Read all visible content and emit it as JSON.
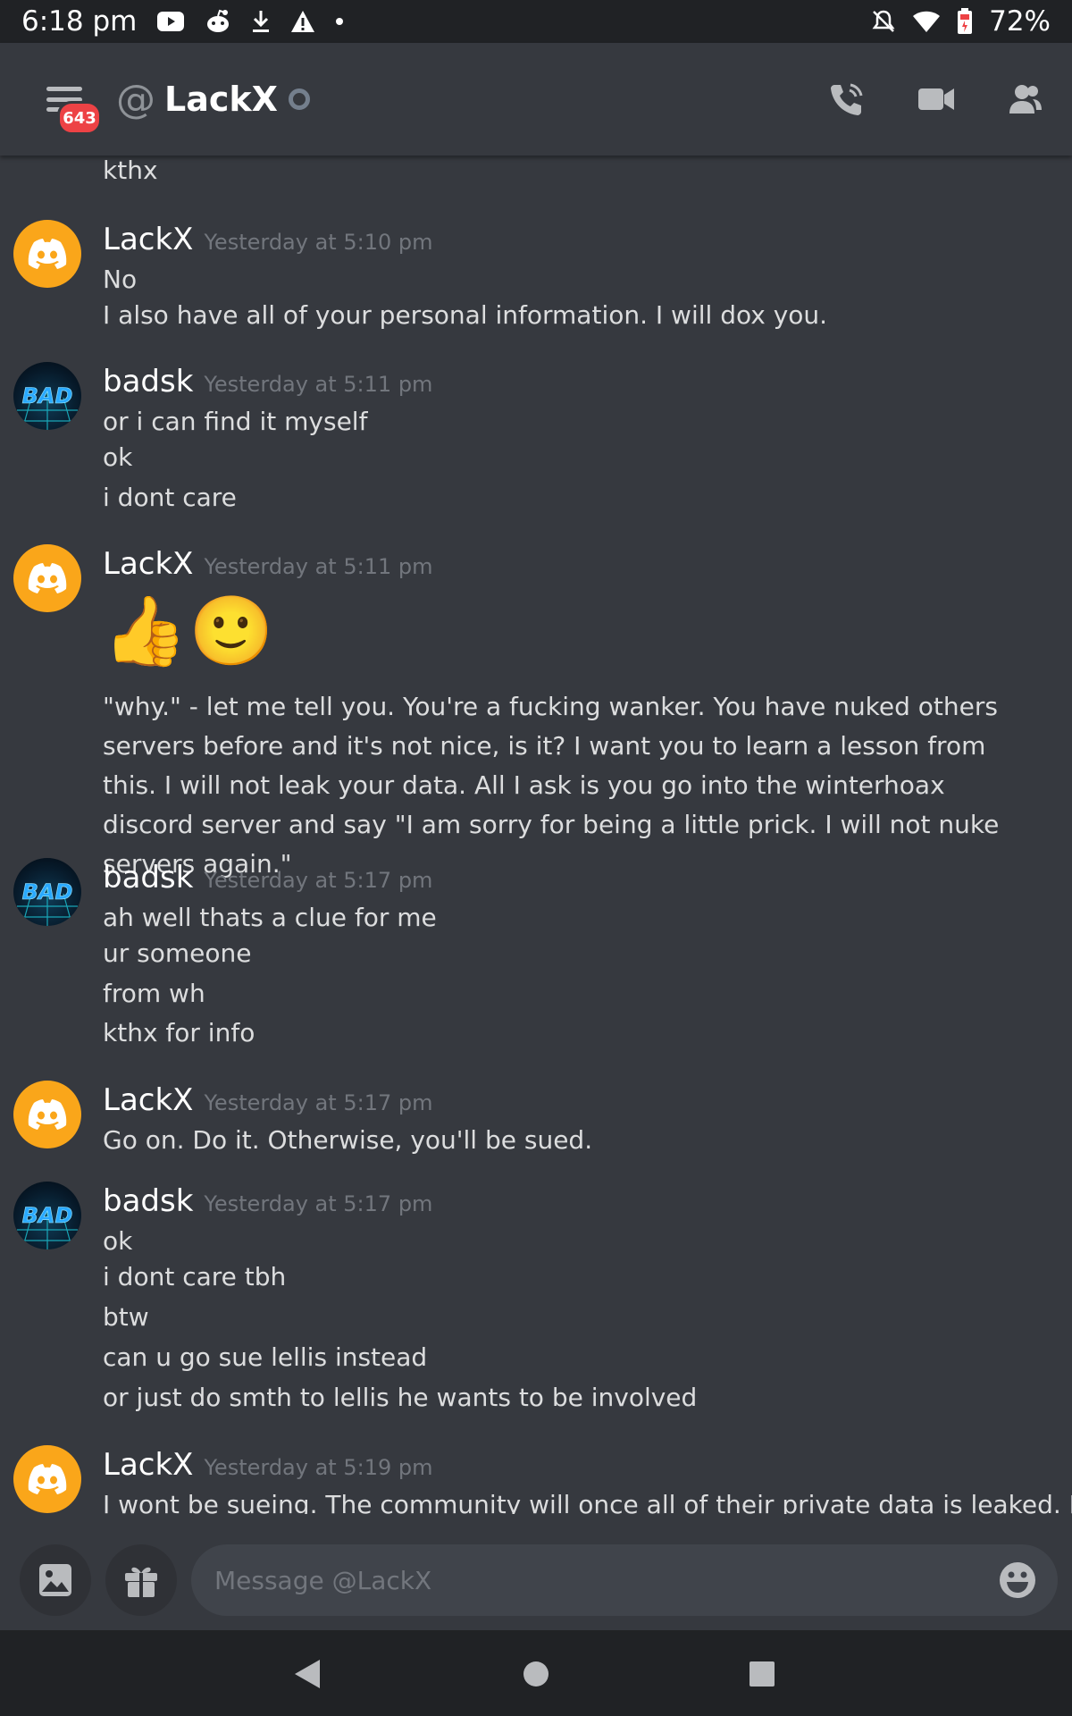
{
  "status_bar": {
    "time": "6:18 pm",
    "battery": "72%",
    "icons_left": [
      "youtube-icon",
      "reddit-icon",
      "download-icon",
      "warning-icon",
      "dot-icon"
    ],
    "icons_right": [
      "notifications-off-icon",
      "wifi-icon",
      "battery-icon"
    ]
  },
  "header": {
    "at_symbol": "@",
    "title": "LackX",
    "unread_badge": "643",
    "actions": [
      "call-icon",
      "video-icon",
      "members-icon"
    ]
  },
  "messages": {
    "top_partial": "kthx",
    "m1": {
      "author": "LackX",
      "timestamp": "Yesterday at 5:10 pm",
      "lines": [
        "No",
        "I also have all of your personal information. I will dox you."
      ]
    },
    "m2": {
      "author": "badsk",
      "timestamp": "Yesterday at 5:11 pm",
      "lines": [
        "or i can find it myself",
        "ok",
        "i dont care"
      ]
    },
    "m3": {
      "author": "LackX",
      "timestamp": "Yesterday at 5:11 pm",
      "emojis": [
        "👍",
        "🙂"
      ],
      "paragraph": "\"why.\" - let me tell you. You're a fucking wanker. You have nuked others servers before and it's not nice, is it? I want you to learn a lesson from this. I will not leak your data. All I ask is you go into the winterhoax discord server and say \"I am sorry for being a little prick. I will not nuke servers again.\""
    },
    "m4": {
      "author": "badsk",
      "timestamp": "Yesterday at 5:17 pm",
      "lines": [
        "ah well thats a clue for me",
        "ur someone",
        "from wh",
        "kthx for info"
      ]
    },
    "m5": {
      "author": "LackX",
      "timestamp": "Yesterday at 5:17 pm",
      "lines": [
        "Go on. Do it. Otherwise, you'll be sued."
      ]
    },
    "m6": {
      "author": "badsk",
      "timestamp": "Yesterday at 5:17 pm",
      "lines": [
        "ok",
        "i dont care tbh",
        "btw",
        "can u go sue lellis instead",
        "or just do smth to lellis he wants to be involved"
      ]
    },
    "m7": {
      "author": "LackX",
      "timestamp": "Yesterday at 5:19 pm",
      "lines": [
        "I wont be sueing. The community will once all of their private data is leaked. Last"
      ]
    }
  },
  "avatars": {
    "lackx_avatar_text": "",
    "badsk_avatar_text": "BAD"
  },
  "composer": {
    "placeholder": "Message @LackX"
  },
  "colors": {
    "background": "#36393f",
    "accent": "#faa61a",
    "badge": "#ed4245"
  }
}
